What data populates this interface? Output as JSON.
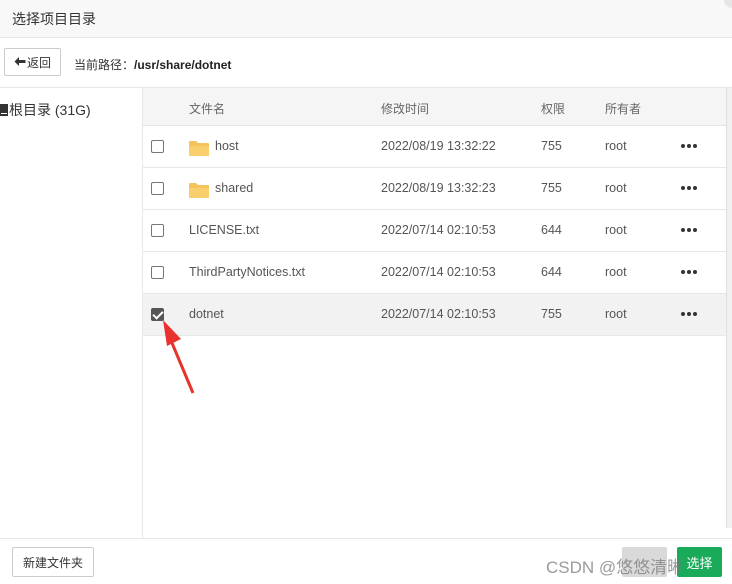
{
  "dialog": {
    "title": "选择项目目录"
  },
  "toolbar": {
    "back_label": "返回",
    "path_label": "当前路径：",
    "path_value": "/usr/share/dotnet"
  },
  "sidebar": {
    "root_label": "根目录 (31G)"
  },
  "table": {
    "headers": {
      "name": "文件名",
      "modified": "修改时间",
      "perm": "权限",
      "owner": "所有者"
    },
    "rows": [
      {
        "type": "folder",
        "name": "host",
        "modified": "2022/08/19 13:32:22",
        "perm": "755",
        "owner": "root",
        "checked": false
      },
      {
        "type": "folder",
        "name": "shared",
        "modified": "2022/08/19 13:32:23",
        "perm": "755",
        "owner": "root",
        "checked": false
      },
      {
        "type": "file",
        "name": "LICENSE.txt",
        "modified": "2022/07/14 02:10:53",
        "perm": "644",
        "owner": "root",
        "checked": false
      },
      {
        "type": "file",
        "name": "ThirdPartyNotices.txt",
        "modified": "2022/07/14 02:10:53",
        "perm": "644",
        "owner": "root",
        "checked": false
      },
      {
        "type": "file",
        "name": "dotnet",
        "modified": "2022/07/14 02:10:53",
        "perm": "755",
        "owner": "root",
        "checked": true
      }
    ]
  },
  "footer": {
    "new_folder_label": "新建文件夹",
    "confirm_label": "选择",
    "watermark": "CSDN @悠悠清晰"
  },
  "colors": {
    "accent_green": "#1aab5a",
    "folder_yellow": "#f5c35a",
    "annotation_red": "#e8322d"
  },
  "icons": [
    "back-arrow-icon",
    "drive-icon",
    "folder-icon",
    "more-icon",
    "annotation-arrow"
  ]
}
